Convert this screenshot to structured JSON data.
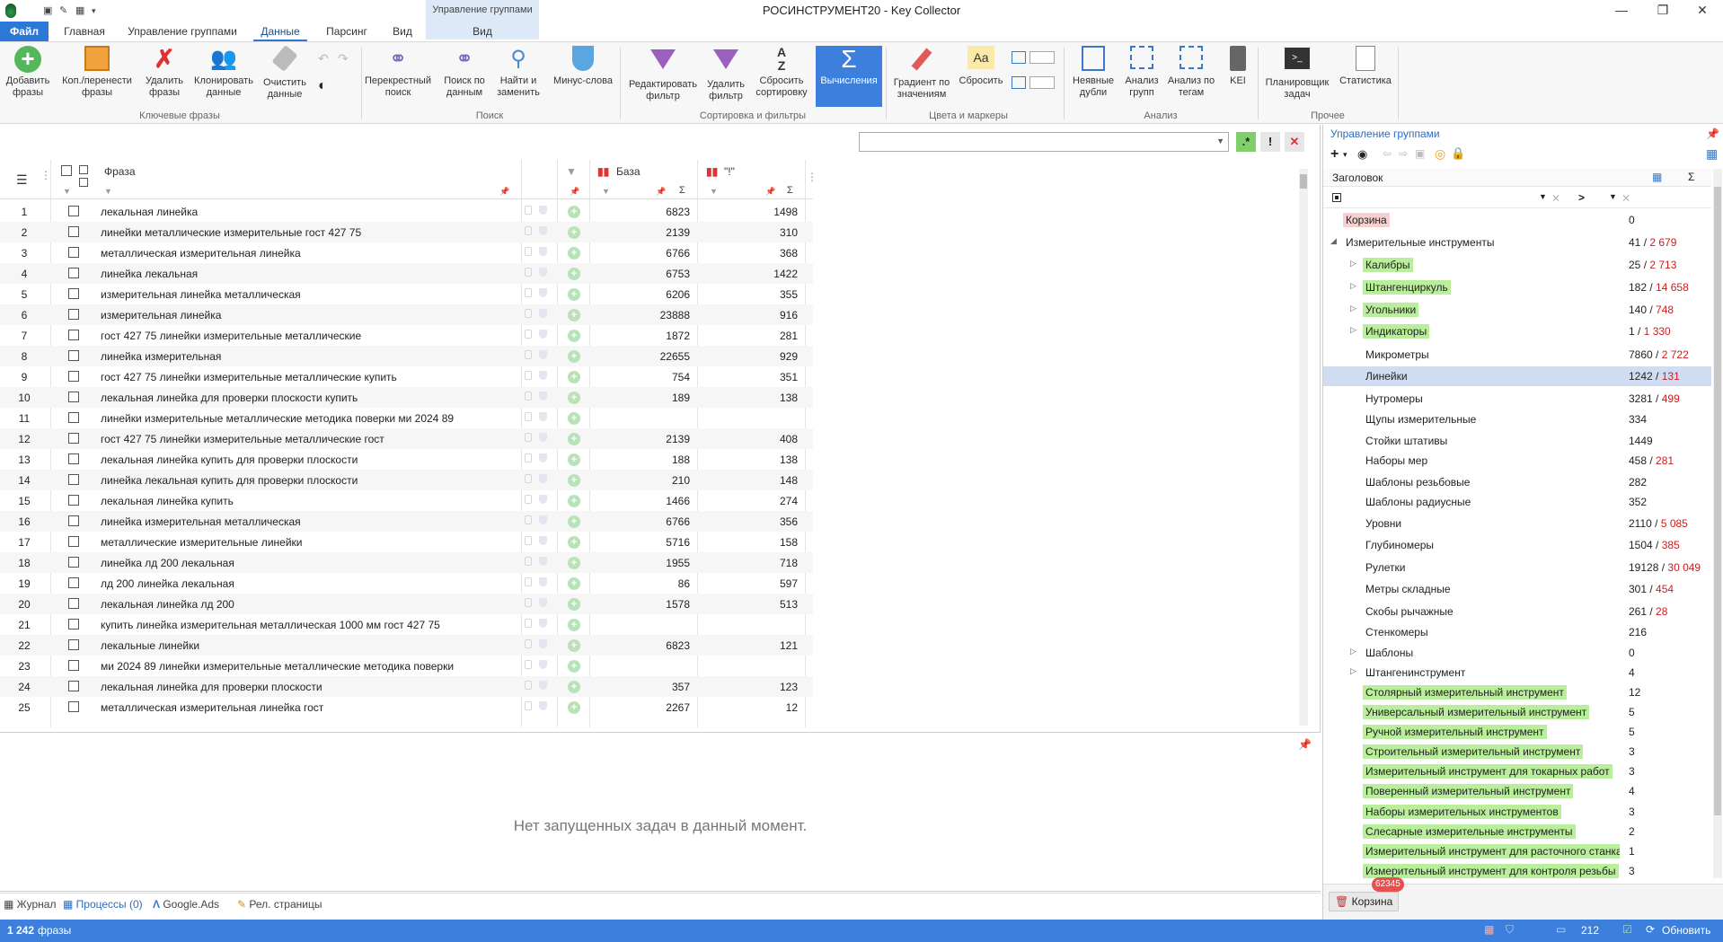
{
  "window": {
    "title": "РОСИНСТРУМЕНТ20 - Key Collector",
    "context_group": "Управление группами",
    "context_tab": "Вид"
  },
  "tabs": [
    "Файл",
    "Главная",
    "Управление группами",
    "Данные",
    "Парсинг",
    "Вид"
  ],
  "active_tab": "Данные",
  "ribbon": {
    "groups": {
      "key": "Ключевые фразы",
      "search": "Поиск",
      "sort": "Сортировка и фильтры",
      "colors": "Цвета и маркеры",
      "analysis": "Анализ",
      "other": "Прочее"
    },
    "buttons": {
      "add": "Добавить фразы",
      "copy": "Коп./перенести фразы",
      "delete": "Удалить фразы",
      "clone": "Клонировать данные",
      "clear": "Очистить данные",
      "cross": "Перекрестный поиск",
      "search": "Поиск по данным",
      "find": "Найти и заменить",
      "minus": "Минус-слова",
      "edit_filter": "Редактировать фильтр",
      "del_filter": "Удалить фильтр",
      "reset_sort": "Сбросить сортировку",
      "calc": "Вычисления",
      "gradient": "Градиент по значениям",
      "reset": "Сбросить",
      "dupes": "Неявные дубли",
      "groups_analysis": "Анализ групп",
      "tags_analysis": "Анализ по тегам",
      "kei": "KEI",
      "planner": "Планировщик задач",
      "stats": "Статистика"
    }
  },
  "grid": {
    "headers": {
      "phrase": "Фраза",
      "base": "База",
      "excl": "\"!\""
    },
    "rows": [
      {
        "n": "1",
        "phrase": "лекальная линейка",
        "base": "6823",
        "excl": "1498"
      },
      {
        "n": "2",
        "phrase": "линейки металлические измерительные гост 427 75",
        "base": "2139",
        "excl": "310"
      },
      {
        "n": "3",
        "phrase": "металлическая измерительная линейка",
        "base": "6766",
        "excl": "368"
      },
      {
        "n": "4",
        "phrase": "линейка лекальная",
        "base": "6753",
        "excl": "1422"
      },
      {
        "n": "5",
        "phrase": "измерительная линейка металлическая",
        "base": "6206",
        "excl": "355"
      },
      {
        "n": "6",
        "phrase": "измерительная линейка",
        "base": "23888",
        "excl": "916"
      },
      {
        "n": "7",
        "phrase": "гост 427 75 линейки измерительные металлические",
        "base": "1872",
        "excl": "281"
      },
      {
        "n": "8",
        "phrase": "линейка измерительная",
        "base": "22655",
        "excl": "929"
      },
      {
        "n": "9",
        "phrase": "гост 427 75 линейки измерительные металлические купить",
        "base": "754",
        "excl": "351"
      },
      {
        "n": "10",
        "phrase": "лекальная линейка для проверки плоскости купить",
        "base": "189",
        "excl": "138"
      },
      {
        "n": "11",
        "phrase": "линейки измерительные металлические методика поверки ми 2024 89",
        "base": "",
        "excl": ""
      },
      {
        "n": "12",
        "phrase": "гост 427 75 линейки измерительные металлические гост",
        "base": "2139",
        "excl": "408"
      },
      {
        "n": "13",
        "phrase": "лекальная линейка купить для проверки плоскости",
        "base": "188",
        "excl": "138"
      },
      {
        "n": "14",
        "phrase": "линейка лекальная купить для проверки плоскости",
        "base": "210",
        "excl": "148"
      },
      {
        "n": "15",
        "phrase": "лекальная линейка купить",
        "base": "1466",
        "excl": "274"
      },
      {
        "n": "16",
        "phrase": "линейка измерительная металлическая",
        "base": "6766",
        "excl": "356"
      },
      {
        "n": "17",
        "phrase": "металлические измерительные линейки",
        "base": "5716",
        "excl": "158"
      },
      {
        "n": "18",
        "phrase": "линейка лд 200 лекальная",
        "base": "1955",
        "excl": "718"
      },
      {
        "n": "19",
        "phrase": "лд 200 линейка лекальная",
        "base": "86",
        "excl": "597"
      },
      {
        "n": "20",
        "phrase": "лекальная линейка лд 200",
        "base": "1578",
        "excl": "513"
      },
      {
        "n": "21",
        "phrase": "купить линейка измерительная металлическая 1000 мм гост 427 75",
        "base": "",
        "excl": ""
      },
      {
        "n": "22",
        "phrase": "лекальные линейки",
        "base": "6823",
        "excl": "121"
      },
      {
        "n": "23",
        "phrase": "ми 2024 89 линейки измерительные металлические методика поверки",
        "base": "",
        "excl": ""
      },
      {
        "n": "24",
        "phrase": "лекальная линейка для проверки плоскости",
        "base": "357",
        "excl": "123"
      },
      {
        "n": "25",
        "phrase": "металлическая измерительная линейка гост",
        "base": "2267",
        "excl": "12"
      }
    ]
  },
  "lower_panel": {
    "message": "Нет запущенных задач в данный момент."
  },
  "bottom_tabs": [
    "Журнал",
    "Процессы (0)",
    "Google.Ads",
    "Рел. страницы"
  ],
  "status": {
    "phrases_count": "1 242",
    "phrases_label": "фразы",
    "right_count": "212",
    "refresh": "Обновить"
  },
  "groups_panel": {
    "title": "Управление группами",
    "header": "Заголовок",
    "filter_op": ">",
    "trash_label": "Корзина",
    "trash_badge": "62345",
    "tree": [
      {
        "name": "Корзина",
        "count": "0",
        "count2": "",
        "style": "pink",
        "level": 0,
        "expander": ""
      },
      {
        "name": "Измерительные инструменты",
        "count": "41",
        "count2": "2 679",
        "style": "",
        "level": 0,
        "expander": "◢"
      },
      {
        "name": "Калибры",
        "count": "25",
        "count2": "2 713",
        "style": "green",
        "level": 1,
        "expander": "▷"
      },
      {
        "name": "Штангенциркуль",
        "count": "182",
        "count2": "14 658",
        "style": "green",
        "level": 1,
        "expander": "▷"
      },
      {
        "name": "Угольники",
        "count": "140",
        "count2": "748",
        "style": "green",
        "level": 1,
        "expander": "▷"
      },
      {
        "name": "Индикаторы",
        "count": "1",
        "count2": "1 330",
        "style": "green",
        "level": 1,
        "expander": "▷"
      },
      {
        "name": "Микрометры",
        "count": "7860",
        "count2": "2 722",
        "style": "",
        "level": 1,
        "expander": ""
      },
      {
        "name": "Линейки",
        "count": "1242",
        "count2": "131",
        "style": "",
        "level": 1,
        "expander": "",
        "selected": true
      },
      {
        "name": "Нутромеры",
        "count": "3281",
        "count2": "499",
        "style": "",
        "level": 1,
        "expander": ""
      },
      {
        "name": "Щупы измерительные",
        "count": "334",
        "count2": "",
        "style": "",
        "level": 1,
        "expander": ""
      },
      {
        "name": "Стойки штативы",
        "count": "1449",
        "count2": "",
        "style": "",
        "level": 1,
        "expander": ""
      },
      {
        "name": " Наборы мер",
        "count": "458",
        "count2": "281",
        "style": "",
        "level": 1,
        "expander": ""
      },
      {
        "name": "Шаблоны резьбовые",
        "count": "282",
        "count2": "",
        "style": "",
        "level": 1,
        "expander": ""
      },
      {
        "name": "Шаблоны радиусные",
        "count": "352",
        "count2": "",
        "style": "",
        "level": 1,
        "expander": ""
      },
      {
        "name": "Уровни",
        "count": "2110",
        "count2": "5 085",
        "style": "",
        "level": 1,
        "expander": ""
      },
      {
        "name": "Глубиномеры",
        "count": "1504",
        "count2": "385",
        "style": "",
        "level": 1,
        "expander": ""
      },
      {
        "name": "Рулетки",
        "count": "19128",
        "count2": "30 049",
        "style": "",
        "level": 1,
        "expander": ""
      },
      {
        "name": "Метры складные",
        "count": "301",
        "count2": "454",
        "style": "",
        "level": 1,
        "expander": ""
      },
      {
        "name": "Скобы рычажные",
        "count": "261",
        "count2": "28",
        "style": "",
        "level": 1,
        "expander": ""
      },
      {
        "name": "Стенкомеры",
        "count": "216",
        "count2": "",
        "style": "",
        "level": 1,
        "expander": ""
      },
      {
        "name": "Шаблоны",
        "count": "0",
        "count2": "",
        "style": "",
        "level": 1,
        "expander": "▷"
      },
      {
        "name": "Штангенинструмент",
        "count": "4",
        "count2": "",
        "style": "",
        "level": 1,
        "expander": "▷"
      },
      {
        "name": "Столярный измерительный инструмент",
        "count": "12",
        "count2": "",
        "style": "green",
        "level": 1,
        "expander": ""
      },
      {
        "name": "Универсальный измерительный инструмент",
        "count": "5",
        "count2": "",
        "style": "green",
        "level": 1,
        "expander": ""
      },
      {
        "name": "Ручной измерительный инструмент",
        "count": "5",
        "count2": "",
        "style": "green",
        "level": 1,
        "expander": ""
      },
      {
        "name": "Строительный измерительный инструмент",
        "count": "3",
        "count2": "",
        "style": "green",
        "level": 1,
        "expander": ""
      },
      {
        "name": "Измерительный инструмент для токарных работ",
        "count": "3",
        "count2": "",
        "style": "green",
        "level": 1,
        "expander": ""
      },
      {
        "name": "Поверенный измерительный инструмент",
        "count": "4",
        "count2": "",
        "style": "green",
        "level": 1,
        "expander": ""
      },
      {
        "name": "Наборы измерительных инструментов",
        "count": "3",
        "count2": "",
        "style": "green",
        "level": 1,
        "expander": ""
      },
      {
        "name": "Слесарные измерительные инструменты",
        "count": "2",
        "count2": "",
        "style": "green",
        "level": 1,
        "expander": ""
      },
      {
        "name": "Измерительный инструмент для расточного станка",
        "count": "1",
        "count2": "",
        "style": "green",
        "level": 1,
        "expander": ""
      },
      {
        "name": "Измерительный инструмент для контроля резьбы",
        "count": "3",
        "count2": "",
        "style": "green",
        "level": 1,
        "expander": ""
      }
    ]
  },
  "colors": {
    "accent": "#3d7fdc",
    "group_green": "#b9ef9a",
    "count_red": "#d01b1b"
  }
}
